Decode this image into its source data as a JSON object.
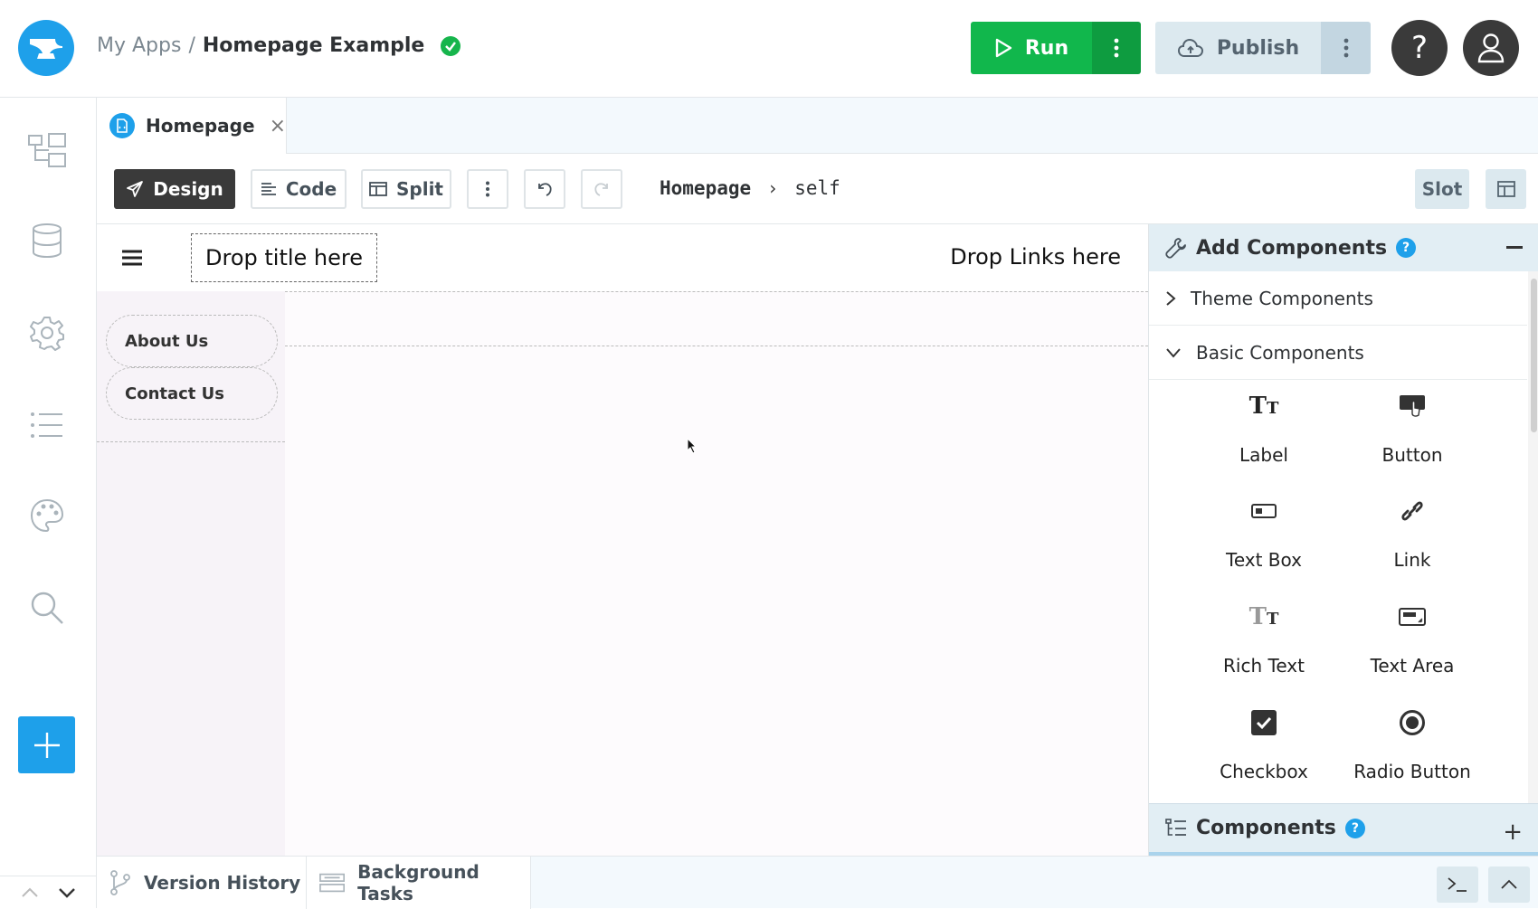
{
  "header": {
    "breadcrumb_root": "My Apps",
    "breadcrumb_sep": "/",
    "app_name": "Homepage Example",
    "run_label": "Run",
    "publish_label": "Publish",
    "help_label": "?"
  },
  "tabs": [
    {
      "label": "Homepage",
      "close": "×"
    }
  ],
  "toolbar": {
    "design_label": "Design",
    "code_label": "Code",
    "split_label": "Split",
    "path_form": "Homepage",
    "path_chevron": "›",
    "path_self": "self",
    "slot_label": "Slot"
  },
  "canvas": {
    "drop_title": "Drop title here",
    "drop_links": "Drop Links here",
    "nav_links": [
      "About Us",
      "Contact Us"
    ]
  },
  "right_panel": {
    "add_components_title": "Add Components",
    "help": "?",
    "sections": [
      {
        "label": "Theme Components",
        "expanded": false
      },
      {
        "label": "Basic Components",
        "expanded": true
      }
    ],
    "components": [
      {
        "label": "Label",
        "icon": "label-icon"
      },
      {
        "label": "Button",
        "icon": "button-icon"
      },
      {
        "label": "Text Box",
        "icon": "textbox-icon"
      },
      {
        "label": "Link",
        "icon": "link-icon"
      },
      {
        "label": "Rich Text",
        "icon": "richtext-icon"
      },
      {
        "label": "Text Area",
        "icon": "textarea-icon"
      },
      {
        "label": "Checkbox",
        "icon": "checkbox-icon"
      },
      {
        "label": "Radio Button",
        "icon": "radio-icon"
      }
    ],
    "components_title": "Components"
  },
  "bottom": {
    "version_history": "Version History",
    "background_tasks": "Background Tasks"
  },
  "colors": {
    "accent": "#1ea0ea",
    "run_green": "#11b74c",
    "publish_bg": "#dce9ef",
    "dark": "#3a3a3a"
  }
}
